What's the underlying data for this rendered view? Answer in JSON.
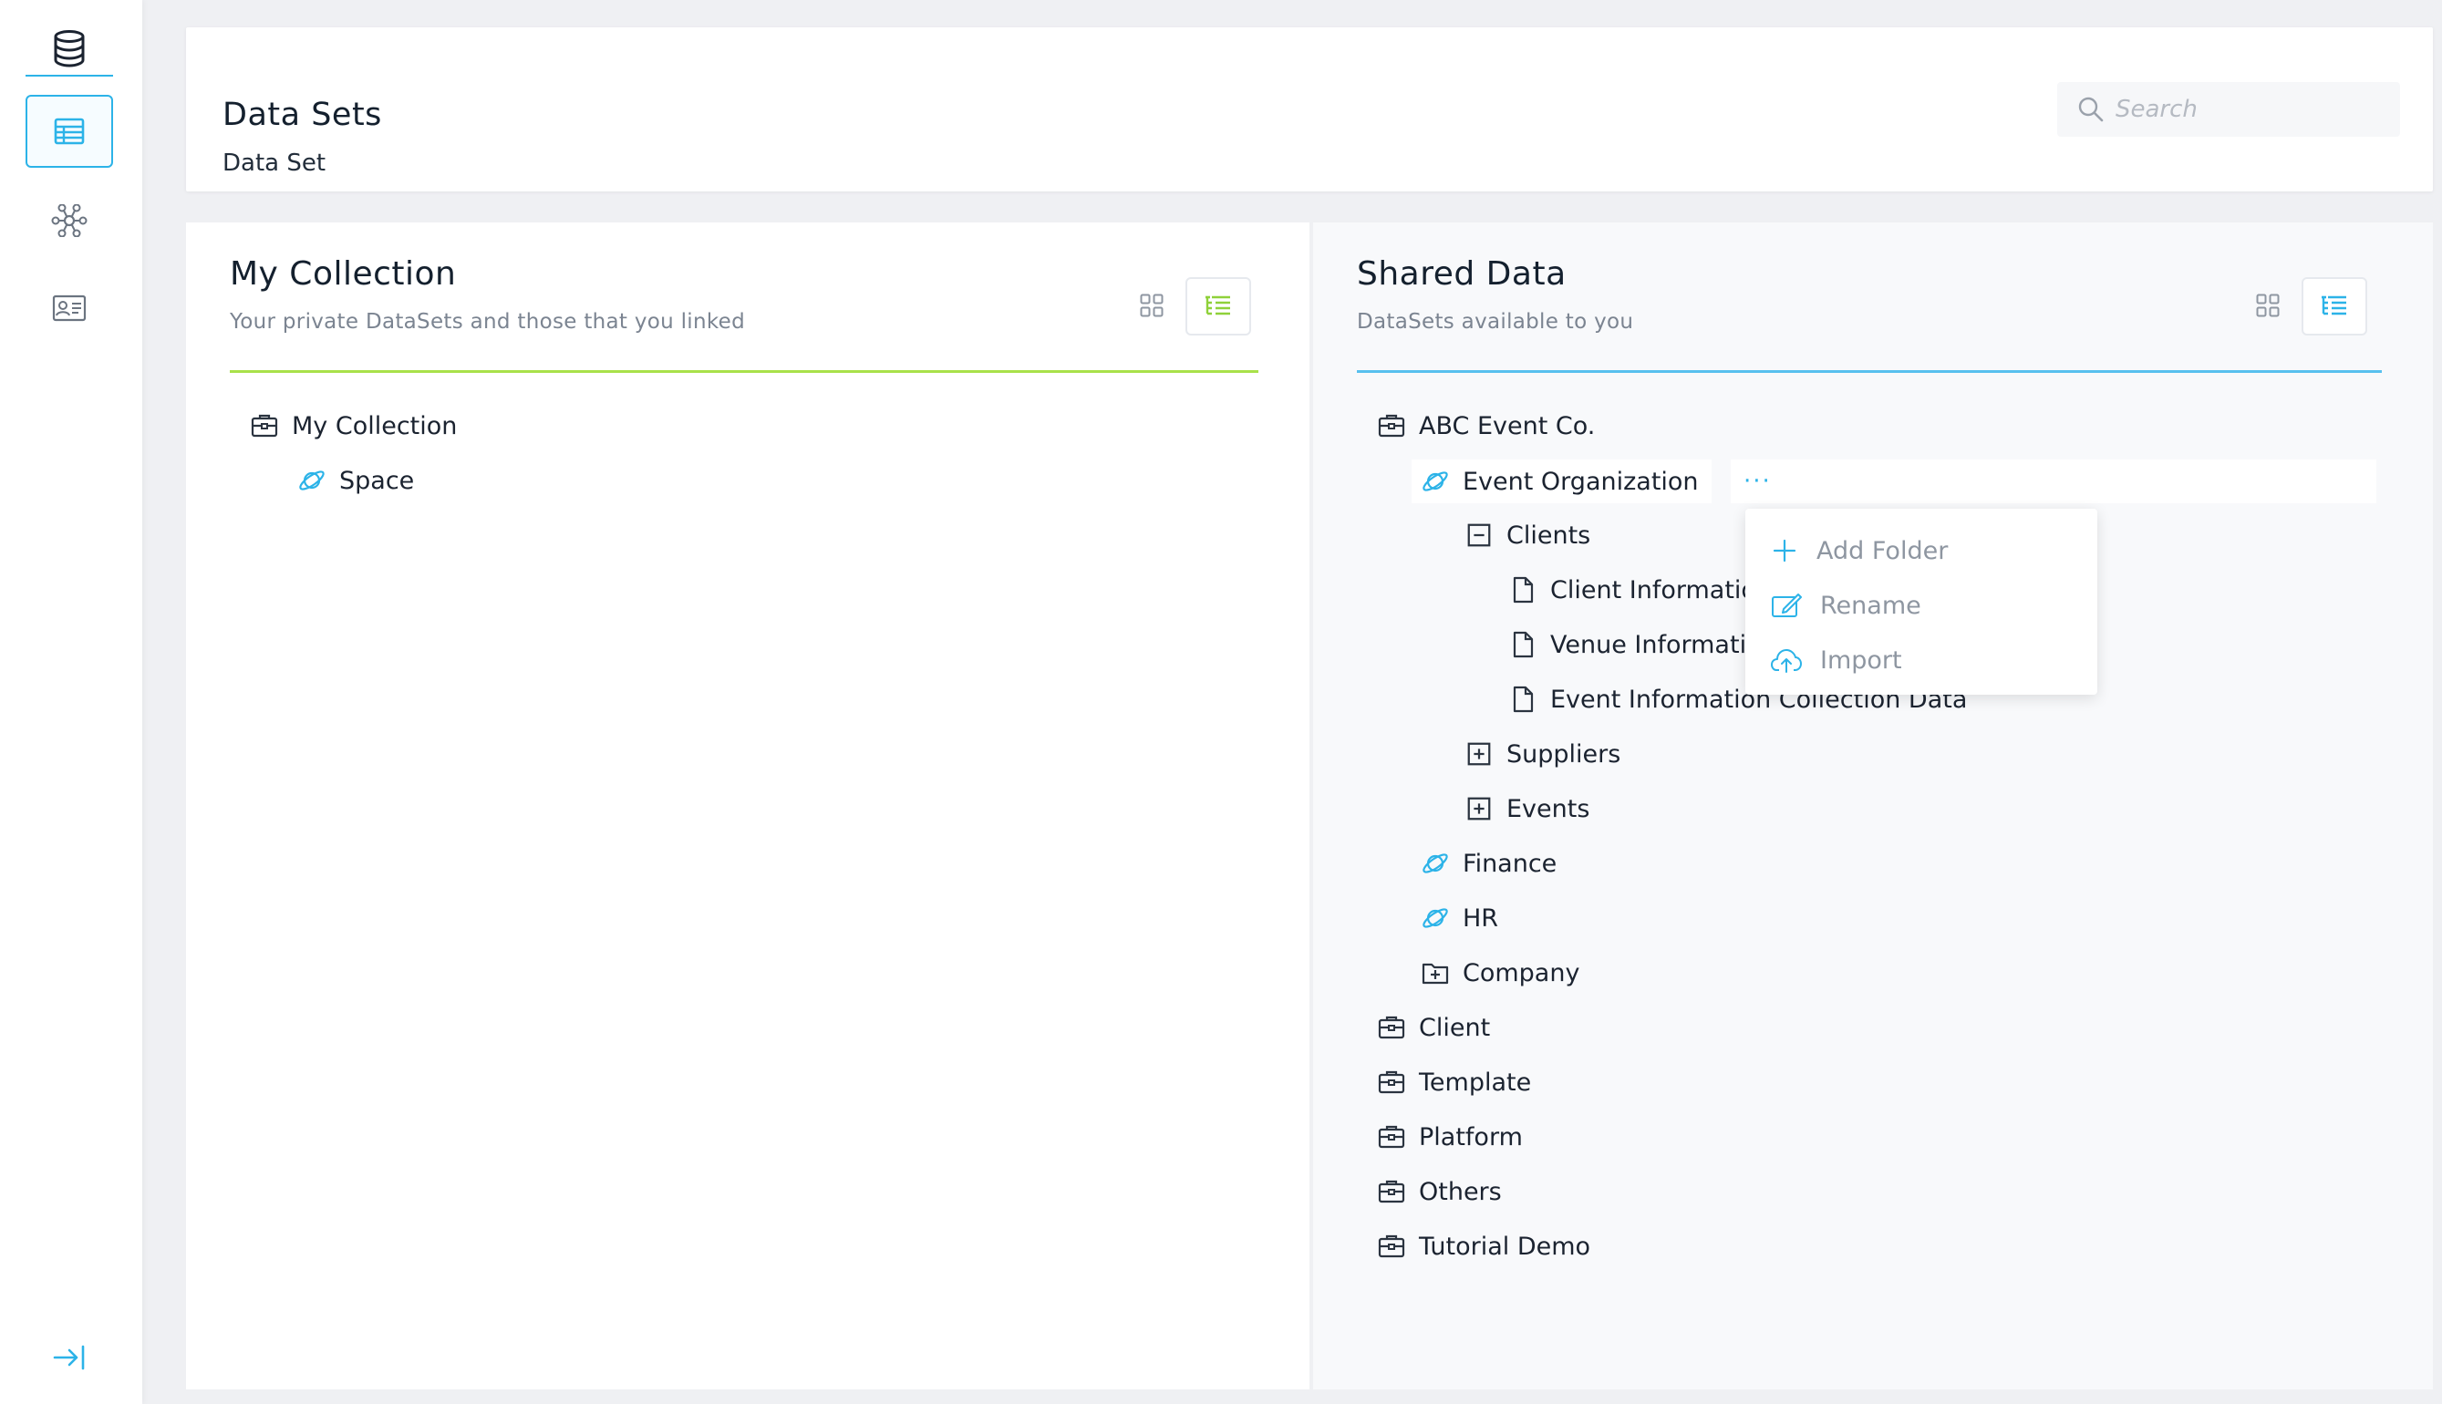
{
  "colors": {
    "accent": "#2cb3e8",
    "my_collection_accent": "#a9e14a",
    "shared_accent": "#58c0ee",
    "icon_dark": "#2b3440",
    "muted_text": "#8e96a1"
  },
  "sidebar": {
    "items": [
      {
        "icon": "database-icon"
      },
      {
        "icon": "table-icon",
        "active": true
      },
      {
        "icon": "network-graph-icon"
      },
      {
        "icon": "contact-card-icon"
      }
    ],
    "collapse_icon": "collapse-right-icon"
  },
  "header": {
    "title": "Data Sets",
    "subtitle": "Data Set",
    "search": {
      "placeholder": "Search",
      "value": ""
    }
  },
  "my_collection": {
    "title": "My Collection",
    "subtitle": "Your private DataSets and those that you linked",
    "tree": [
      {
        "label": "My Collection",
        "icon": "briefcase-icon"
      },
      {
        "label": "Space",
        "icon": "planet-icon"
      }
    ]
  },
  "shared_data": {
    "title": "Shared Data",
    "subtitle": "DataSets available to you",
    "more_label": "···",
    "tree": [
      {
        "label": "ABC Event Co.",
        "icon": "briefcase-icon"
      },
      {
        "label": "Event Organization",
        "icon": "planet-icon"
      },
      {
        "label": "Clients",
        "icon": "collapse-box-icon"
      },
      {
        "label": "Client Information",
        "icon": "file-icon"
      },
      {
        "label": "Venue Information",
        "icon": "file-icon"
      },
      {
        "label": "Event Information Collection Data",
        "icon": "file-icon"
      },
      {
        "label": "Suppliers",
        "icon": "expand-box-icon"
      },
      {
        "label": "Events",
        "icon": "expand-box-icon"
      },
      {
        "label": "Finance",
        "icon": "planet-icon"
      },
      {
        "label": "HR",
        "icon": "planet-icon"
      },
      {
        "label": "Company",
        "icon": "folder-plus-icon"
      },
      {
        "label": "Client",
        "icon": "briefcase-icon"
      },
      {
        "label": "Template",
        "icon": "briefcase-icon"
      },
      {
        "label": "Platform",
        "icon": "briefcase-icon"
      },
      {
        "label": "Others",
        "icon": "briefcase-icon"
      },
      {
        "label": "Tutorial Demo",
        "icon": "briefcase-icon"
      }
    ]
  },
  "context_menu": {
    "items": [
      {
        "label": "Add Folder",
        "icon": "plus-icon"
      },
      {
        "label": "Rename",
        "icon": "edit-icon"
      },
      {
        "label": "Import",
        "icon": "cloud-upload-icon"
      }
    ]
  }
}
